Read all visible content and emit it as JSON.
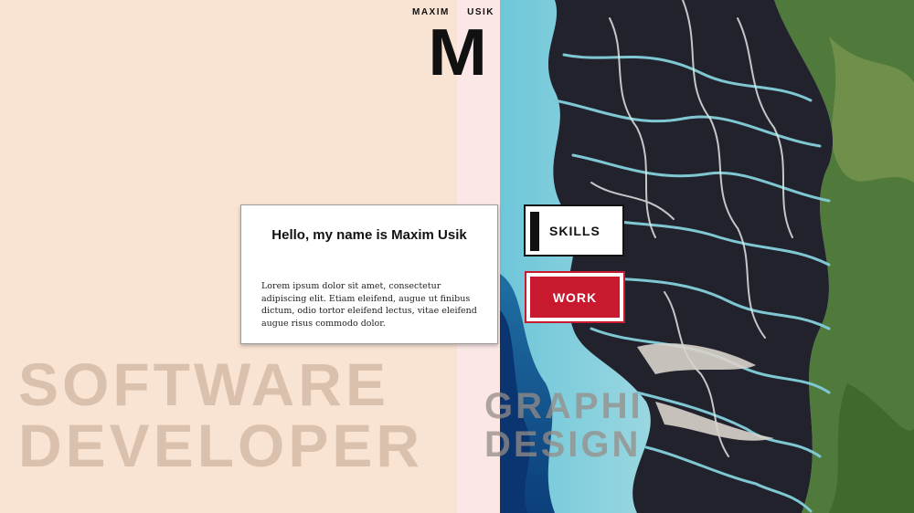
{
  "brand": {
    "first_name": "MAXIM",
    "last_name": "USIK",
    "logo_letter": "M"
  },
  "intro": {
    "title": "Hello, my name is Maxim Usik",
    "body": "Lorem ipsum dolor sit amet, consectetur adipiscing elit. Etiam eleifend, augue ut finibus dictum, odio tortor eleifend lectus, vitae eleifend augue risus commodo dolor."
  },
  "nav": {
    "skills_label": "SKILLS",
    "work_label": "WORK"
  },
  "headings": {
    "left_line1": "SOFTWARE",
    "left_line2": "DEVELOPER",
    "right_line1": "GRAPHIC",
    "right_line2": "DESIGNER"
  },
  "colors": {
    "left_background": "#f9e3d3",
    "strip": "#fbe8e6",
    "accent_red": "#c8192f",
    "ink": "#111111"
  },
  "icons": {
    "hero": "satellite-river-delta-image"
  }
}
